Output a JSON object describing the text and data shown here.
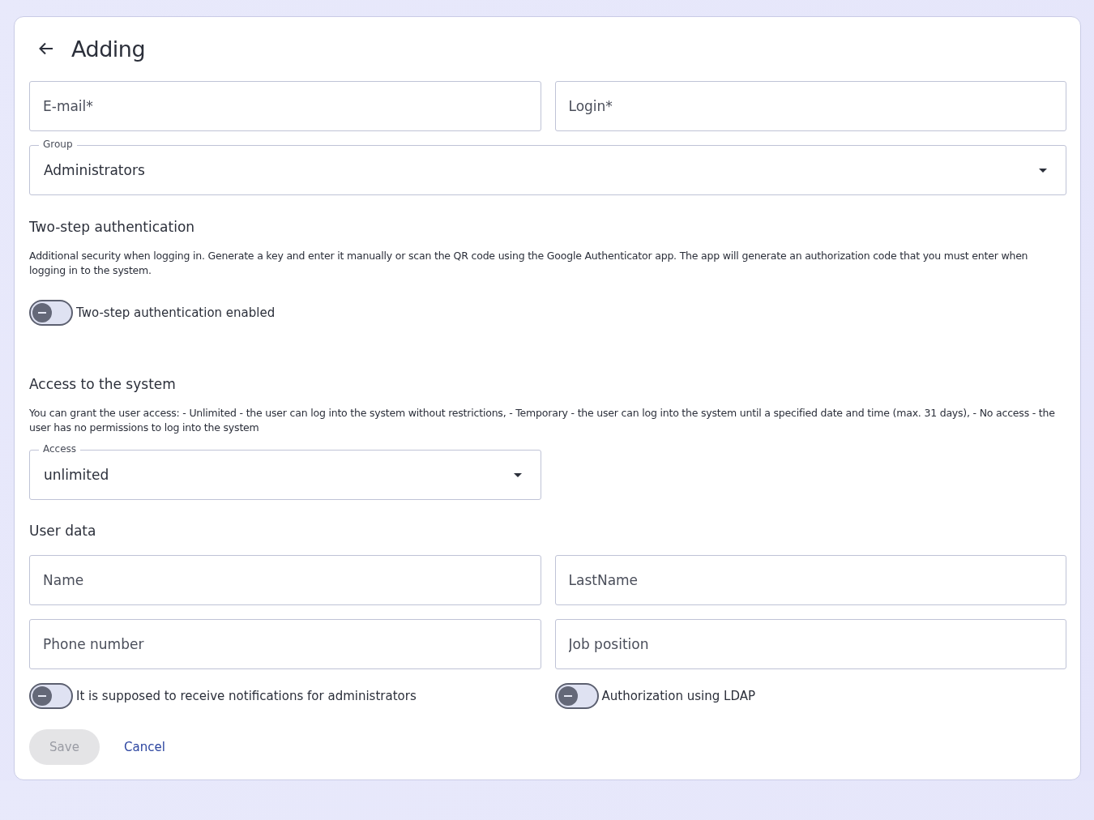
{
  "header": {
    "title": "Adding"
  },
  "account_fields": [
    {
      "placeholder": "E-mail*"
    },
    {
      "placeholder": "Login*"
    }
  ],
  "group_select": {
    "label": "Group",
    "value": "Administrators"
  },
  "two_step": {
    "heading": "Two-step authentication",
    "description": "Additional security when logging in. Generate a key and enter it manually or scan the QR code using the Google Authenticator app. The app will generate an authorization code that you must enter when logging in to the system.",
    "toggle": {
      "label": "Two-step authentication enabled",
      "on": false
    }
  },
  "access": {
    "heading": "Access to the system",
    "description": "You can grant the user access: - Unlimited - the user can log into the system without restrictions, - Temporary - the user can log into the system until a specified date and time (max. 31 days), - No access - the user has no permissions to log into the system",
    "select": {
      "label": "Access",
      "value": "unlimited"
    }
  },
  "user_data": {
    "heading": "User data",
    "fields": [
      {
        "placeholder": "Name"
      },
      {
        "placeholder": "LastName"
      },
      {
        "placeholder": "Phone number"
      },
      {
        "placeholder": "Job position"
      }
    ],
    "toggles": [
      {
        "label": "It is supposed to receive notifications for administrators",
        "on": false
      },
      {
        "label": "Authorization using LDAP",
        "on": false
      }
    ]
  },
  "buttons": {
    "save": {
      "label": "Save",
      "disabled": true
    },
    "cancel": {
      "label": "Cancel"
    }
  }
}
